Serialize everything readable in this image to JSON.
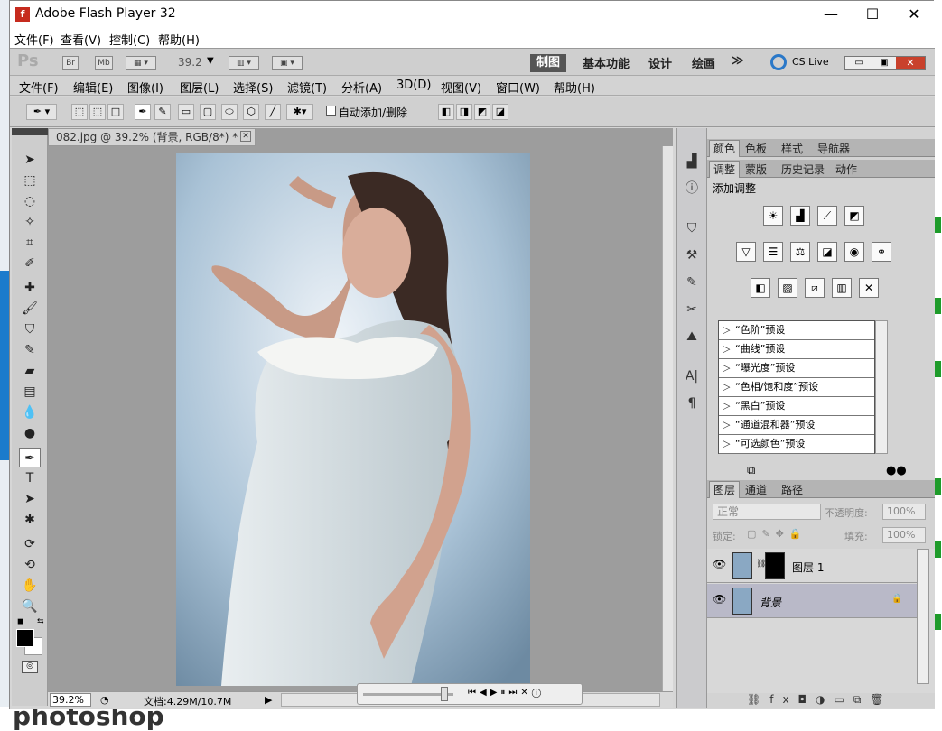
{
  "window": {
    "title": "Adobe Flash Player 32",
    "minimize": "—",
    "maximize": "☐",
    "close": "✕"
  },
  "flash_menu": [
    "文件(F)",
    "查看(V)",
    "控制(C)",
    "帮助(H)"
  ],
  "appbar": {
    "logo": "Ps",
    "br": "Br",
    "mb": "Mb",
    "zoom": "39.2",
    "workspaces": [
      "制图",
      "基本功能",
      "设计",
      "绘画"
    ],
    "more": "≫",
    "cslive": "CS Live"
  },
  "ps_menu": [
    "文件(F)",
    "编辑(E)",
    "图像(I)",
    "图层(L)",
    "选择(S)",
    "滤镜(T)",
    "分析(A)",
    "3D(D)",
    "视图(V)",
    "窗口(W)",
    "帮助(H)"
  ],
  "options": {
    "auto_add_delete": "自动添加/删除"
  },
  "document": {
    "tab_title": "082.jpg @ 39.2% (背景, RGB/8*) *",
    "zoom": "39.2%",
    "doc_size": "文档:4.29M/10.7M"
  },
  "panels": {
    "top_tabs": [
      "颜色",
      "色板",
      "样式",
      "导航器"
    ],
    "adj_tabs": [
      "调整",
      "蒙版",
      "历史记录",
      "动作"
    ],
    "adj_title": "添加调整",
    "presets": [
      "“色阶”预设",
      "“曲线”预设",
      "“曝光度”预设",
      "“色相/饱和度”预设",
      "“黑白”预设",
      "“通道混和器”预设",
      "“可选颜色”预设"
    ],
    "layer_tabs": [
      "图层",
      "通道",
      "路径"
    ],
    "blend_mode": "正常",
    "opacity_label": "不透明度:",
    "opacity_value": "100%",
    "lock_label": "锁定:",
    "fill_label": "填充:",
    "fill_value": "100%",
    "layers": [
      {
        "name": "图层 1"
      },
      {
        "name": "背景"
      }
    ]
  },
  "desktop": {
    "bottom_text": "photoshop"
  }
}
